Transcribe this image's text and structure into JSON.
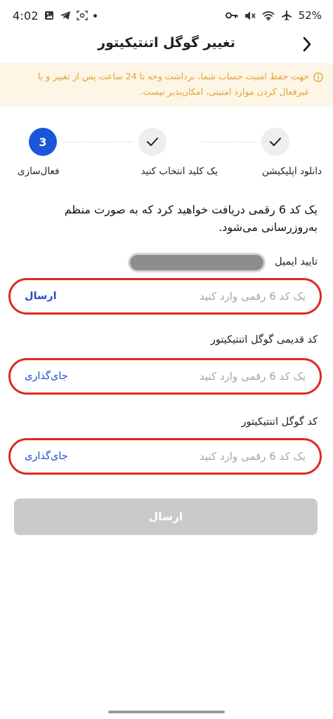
{
  "status_bar": {
    "time": "4:02",
    "battery": "52%"
  },
  "header": {
    "title": "تغییر گوگل اتنتیکیتور"
  },
  "warning": {
    "text": "جهت حفظ امنیت حساب شما، برداشت وجه تا 24 ساعت پس از تغییر و یا غیرفعال کردن موارد امنیتی، امکان‌پذیر نیست."
  },
  "stepper": {
    "steps": [
      {
        "label": "دانلود اپلیکیشن",
        "state": "done"
      },
      {
        "label": "یک کلید انتخاب کنید",
        "state": "done"
      },
      {
        "label": "فعال‌سازی",
        "state": "active",
        "number": "3"
      }
    ]
  },
  "description": "یک کد 6 رقمی دریافت خواهید کرد که به صورت منظم به‌روزرسانی می‌شود.",
  "fields": {
    "email": {
      "label": "تایید ایمیل",
      "placeholder": "یک کد 6 رقمی وارد کنید",
      "action": "ارسال"
    },
    "old_code": {
      "label": "کد قدیمی گوگل اتنتیکیتور",
      "placeholder": "یک کد 6 رقمی وارد کنید",
      "action": "جای‌گذاری"
    },
    "new_code": {
      "label": "کد گوگل اتنتیکیتور",
      "placeholder": "یک کد 6 رقمی وارد کنید",
      "action": "جای‌گذاری"
    }
  },
  "submit": {
    "label": "ارسال"
  },
  "colors": {
    "primary": "#1a56db",
    "link": "#2151c9",
    "warning_text": "#e3a13a",
    "warning_bg": "#fdf5e6",
    "highlight": "#e1281c",
    "disabled": "#c9cacc"
  }
}
